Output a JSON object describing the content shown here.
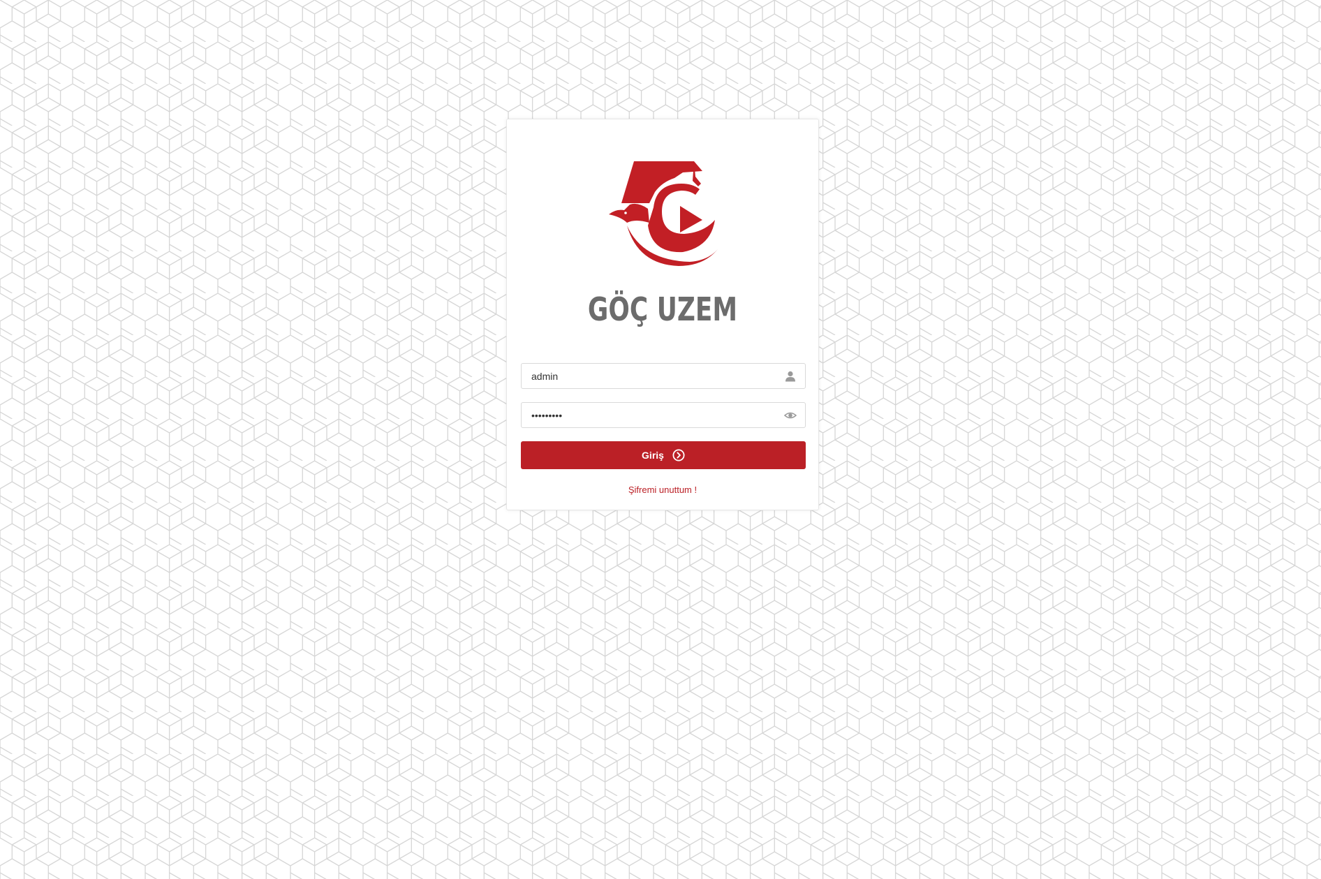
{
  "brand": {
    "name": "GÖÇ UZEM",
    "logo_icon": "graduation-cap-bird-play-icon",
    "accent_color": "#bb2026",
    "text_color": "#6c6c6c"
  },
  "login_form": {
    "username": {
      "value": "admin",
      "icon": "user-icon"
    },
    "password": {
      "value": "•••••••••",
      "icon": "eye-icon"
    },
    "submit_label": "Giriş",
    "submit_icon": "circle-chevron-right-icon",
    "forgot_password_label": "Şifremi unuttum !"
  },
  "background": {
    "pattern": "geometric-cube-lattice",
    "line_color": "#d6d6d6"
  }
}
